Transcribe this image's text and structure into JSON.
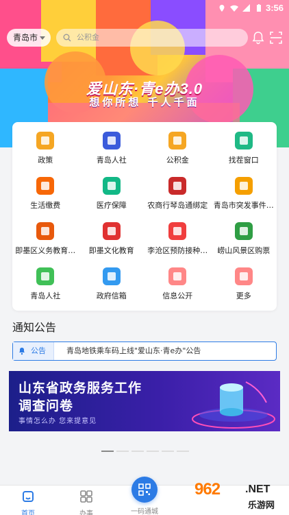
{
  "status_bar": {
    "time": "3:56"
  },
  "header": {
    "city": "青岛市",
    "search_placeholder": "公积金"
  },
  "banner": {
    "title": "爱山东·青e办3.0",
    "slogan": "想你所想 千人千面"
  },
  "services": [
    {
      "label": "政策",
      "icon": "policy-book-icon",
      "color": "#f5a623"
    },
    {
      "label": "青岛人社",
      "icon": "briefcase-icon",
      "color": "#3b5bdb"
    },
    {
      "label": "公积金",
      "icon": "house-fund-icon",
      "color": "#f5a623"
    },
    {
      "label": "找茬窗口",
      "icon": "magnifier-icon",
      "color": "#1fb985"
    },
    {
      "label": "生活缴费",
      "icon": "yuan-coin-icon",
      "color": "#f76707"
    },
    {
      "label": "医疗保障",
      "icon": "medical-kit-icon",
      "color": "#12b886"
    },
    {
      "label": "农商行琴岛通绑定",
      "icon": "bank-logo-icon",
      "color": "#c92a2a"
    },
    {
      "label": "青岛市突发事件…",
      "icon": "alert-icon",
      "color": "#f59f00"
    },
    {
      "label": "即墨区义务教育…",
      "icon": "document-icon",
      "color": "#e8590c"
    },
    {
      "label": "即墨文化教育",
      "icon": "ticket-tag-icon",
      "color": "#e03131"
    },
    {
      "label": "李沧区预防接种…",
      "icon": "first-aid-icon",
      "color": "#f03e3e"
    },
    {
      "label": "崂山风景区购票",
      "icon": "scenic-ticket-icon",
      "color": "#2f9e44"
    },
    {
      "label": "青岛人社",
      "icon": "social-security-icon",
      "color": "#40c057"
    },
    {
      "label": "政府信箱",
      "icon": "mailbox-person-icon",
      "color": "#339af0"
    },
    {
      "label": "信息公开",
      "icon": "info-chat-icon",
      "color": "#ff8787"
    },
    {
      "label": "更多",
      "icon": "more-grid-icon",
      "color": "#ff8787"
    }
  ],
  "notice": {
    "section_title": "通知公告",
    "tag": "公告",
    "text": "青岛地铁乘车码上线\"爱山东·青e办\"公告"
  },
  "survey_banner": {
    "line1": "山东省政务服务工作",
    "line2": "调查问卷",
    "line3": "事情怎么办 您来提意见"
  },
  "carousel": {
    "count": 6,
    "active": 0
  },
  "bottom_nav": {
    "home": "首页",
    "tasks": "办事",
    "scan": "一码通城"
  },
  "watermark": {
    "brand": "962",
    "suffix": ".NET",
    "cn": "乐游网"
  }
}
